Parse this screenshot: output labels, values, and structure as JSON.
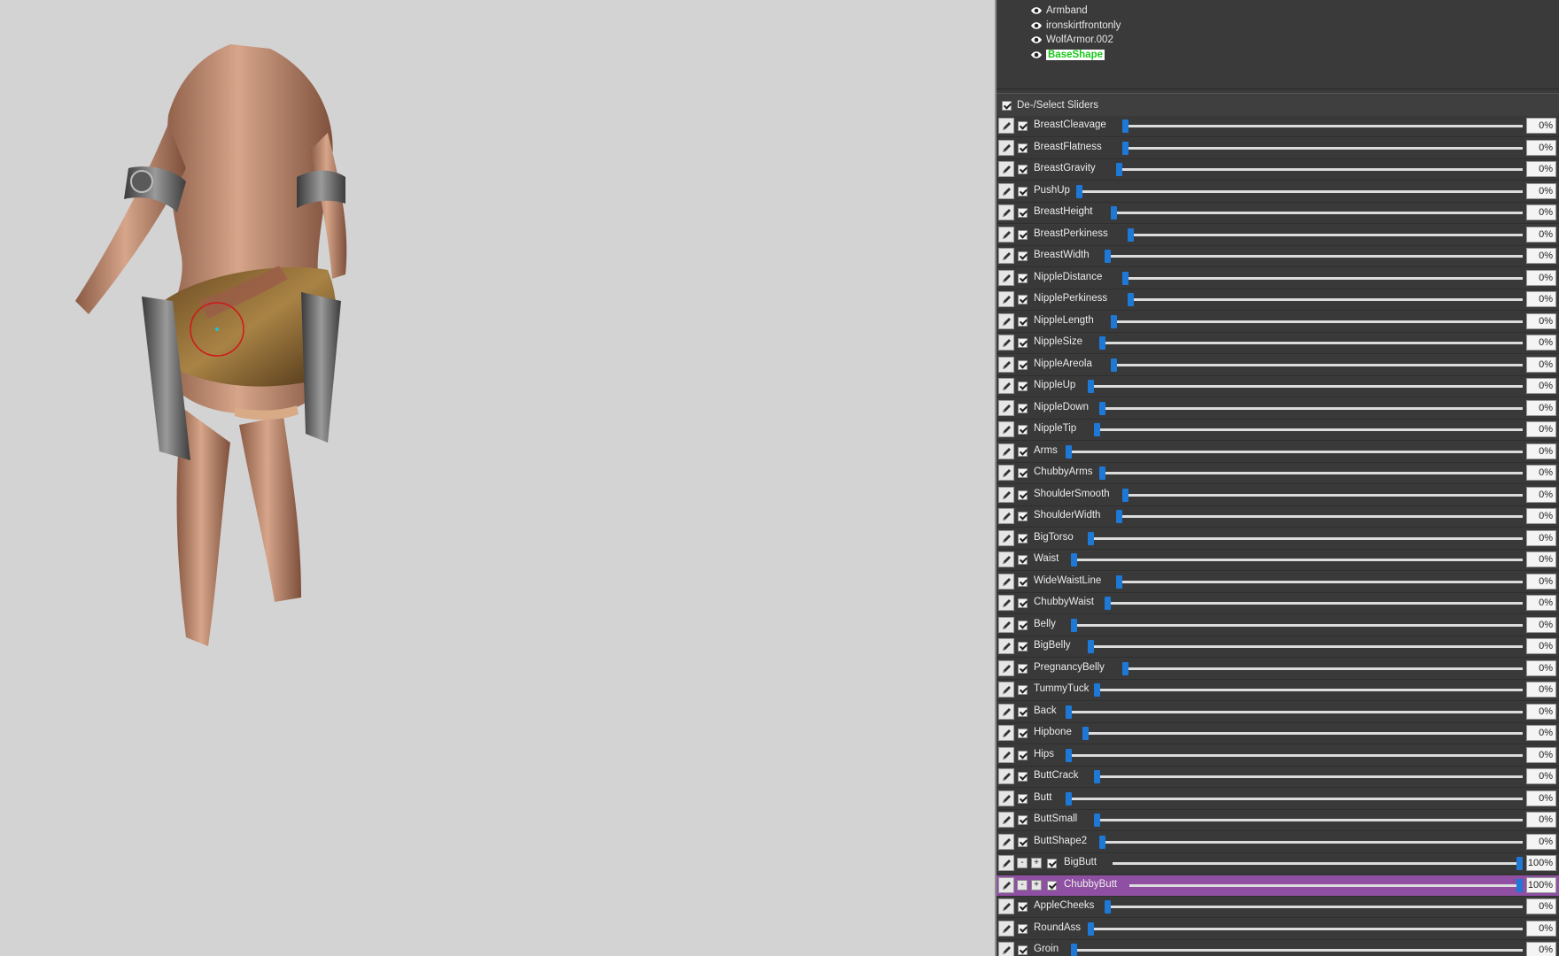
{
  "tree": {
    "items": [
      {
        "label": "Armband",
        "selected": false
      },
      {
        "label": "ironskirtfrontonly",
        "selected": false
      },
      {
        "label": "WolfArmor.002",
        "selected": false
      },
      {
        "label": "BaseShape",
        "selected": true
      }
    ]
  },
  "sliders_header": {
    "label": "De-/Select Sliders",
    "checked": true
  },
  "colors": {
    "accent": "#1e78d6",
    "active_row": "#8f4fa3",
    "selected_text": "#18c818"
  },
  "sliders": [
    {
      "name": "BreastCleavage",
      "value": 0,
      "display": "0%"
    },
    {
      "name": "BreastFlatness",
      "value": 0,
      "display": "0%"
    },
    {
      "name": "BreastGravity",
      "value": 0,
      "display": "0%"
    },
    {
      "name": "PushUp",
      "value": 0,
      "display": "0%"
    },
    {
      "name": "BreastHeight",
      "value": 0,
      "display": "0%"
    },
    {
      "name": "BreastPerkiness",
      "value": 0,
      "display": "0%"
    },
    {
      "name": "BreastWidth",
      "value": 0,
      "display": "0%"
    },
    {
      "name": "NippleDistance",
      "value": 0,
      "display": "0%"
    },
    {
      "name": "NipplePerkiness",
      "value": 0,
      "display": "0%"
    },
    {
      "name": "NippleLength",
      "value": 0,
      "display": "0%"
    },
    {
      "name": "NippleSize",
      "value": 0,
      "display": "0%"
    },
    {
      "name": "NippleAreola",
      "value": 0,
      "display": "0%"
    },
    {
      "name": "NippleUp",
      "value": 0,
      "display": "0%"
    },
    {
      "name": "NippleDown",
      "value": 0,
      "display": "0%"
    },
    {
      "name": "NippleTip",
      "value": 0,
      "display": "0%"
    },
    {
      "name": "Arms",
      "value": 0,
      "display": "0%"
    },
    {
      "name": "ChubbyArms",
      "value": 0,
      "display": "0%"
    },
    {
      "name": "ShoulderSmooth",
      "value": 0,
      "display": "0%"
    },
    {
      "name": "ShoulderWidth",
      "value": 0,
      "display": "0%"
    },
    {
      "name": "BigTorso",
      "value": 0,
      "display": "0%"
    },
    {
      "name": "Waist",
      "value": 0,
      "display": "0%"
    },
    {
      "name": "WideWaistLine",
      "value": 0,
      "display": "0%"
    },
    {
      "name": "ChubbyWaist",
      "value": 0,
      "display": "0%"
    },
    {
      "name": "Belly",
      "value": 0,
      "display": "0%"
    },
    {
      "name": "BigBelly",
      "value": 0,
      "display": "0%"
    },
    {
      "name": "PregnancyBelly",
      "value": 0,
      "display": "0%"
    },
    {
      "name": "TummyTuck",
      "value": 0,
      "display": "0%"
    },
    {
      "name": "Back",
      "value": 0,
      "display": "0%"
    },
    {
      "name": "Hipbone",
      "value": 0,
      "display": "0%"
    },
    {
      "name": "Hips",
      "value": 0,
      "display": "0%"
    },
    {
      "name": "ButtCrack",
      "value": 0,
      "display": "0%"
    },
    {
      "name": "Butt",
      "value": 0,
      "display": "0%"
    },
    {
      "name": "ButtSmall",
      "value": 0,
      "display": "0%"
    },
    {
      "name": "ButtShape2",
      "value": 0,
      "display": "0%"
    },
    {
      "name": "BigButt",
      "value": 100,
      "display": "100%",
      "extended": true
    },
    {
      "name": "ChubbyButt",
      "value": 100,
      "display": "100%",
      "extended": true,
      "active": true
    },
    {
      "name": "AppleCheeks",
      "value": 0,
      "display": "0%"
    },
    {
      "name": "RoundAss",
      "value": 0,
      "display": "0%"
    },
    {
      "name": "Groin",
      "value": 0,
      "display": "0%"
    }
  ],
  "edit_icon": "pencil-icon",
  "visibility_icon": "eye-icon",
  "minus_label": "-",
  "plus_label": "+"
}
